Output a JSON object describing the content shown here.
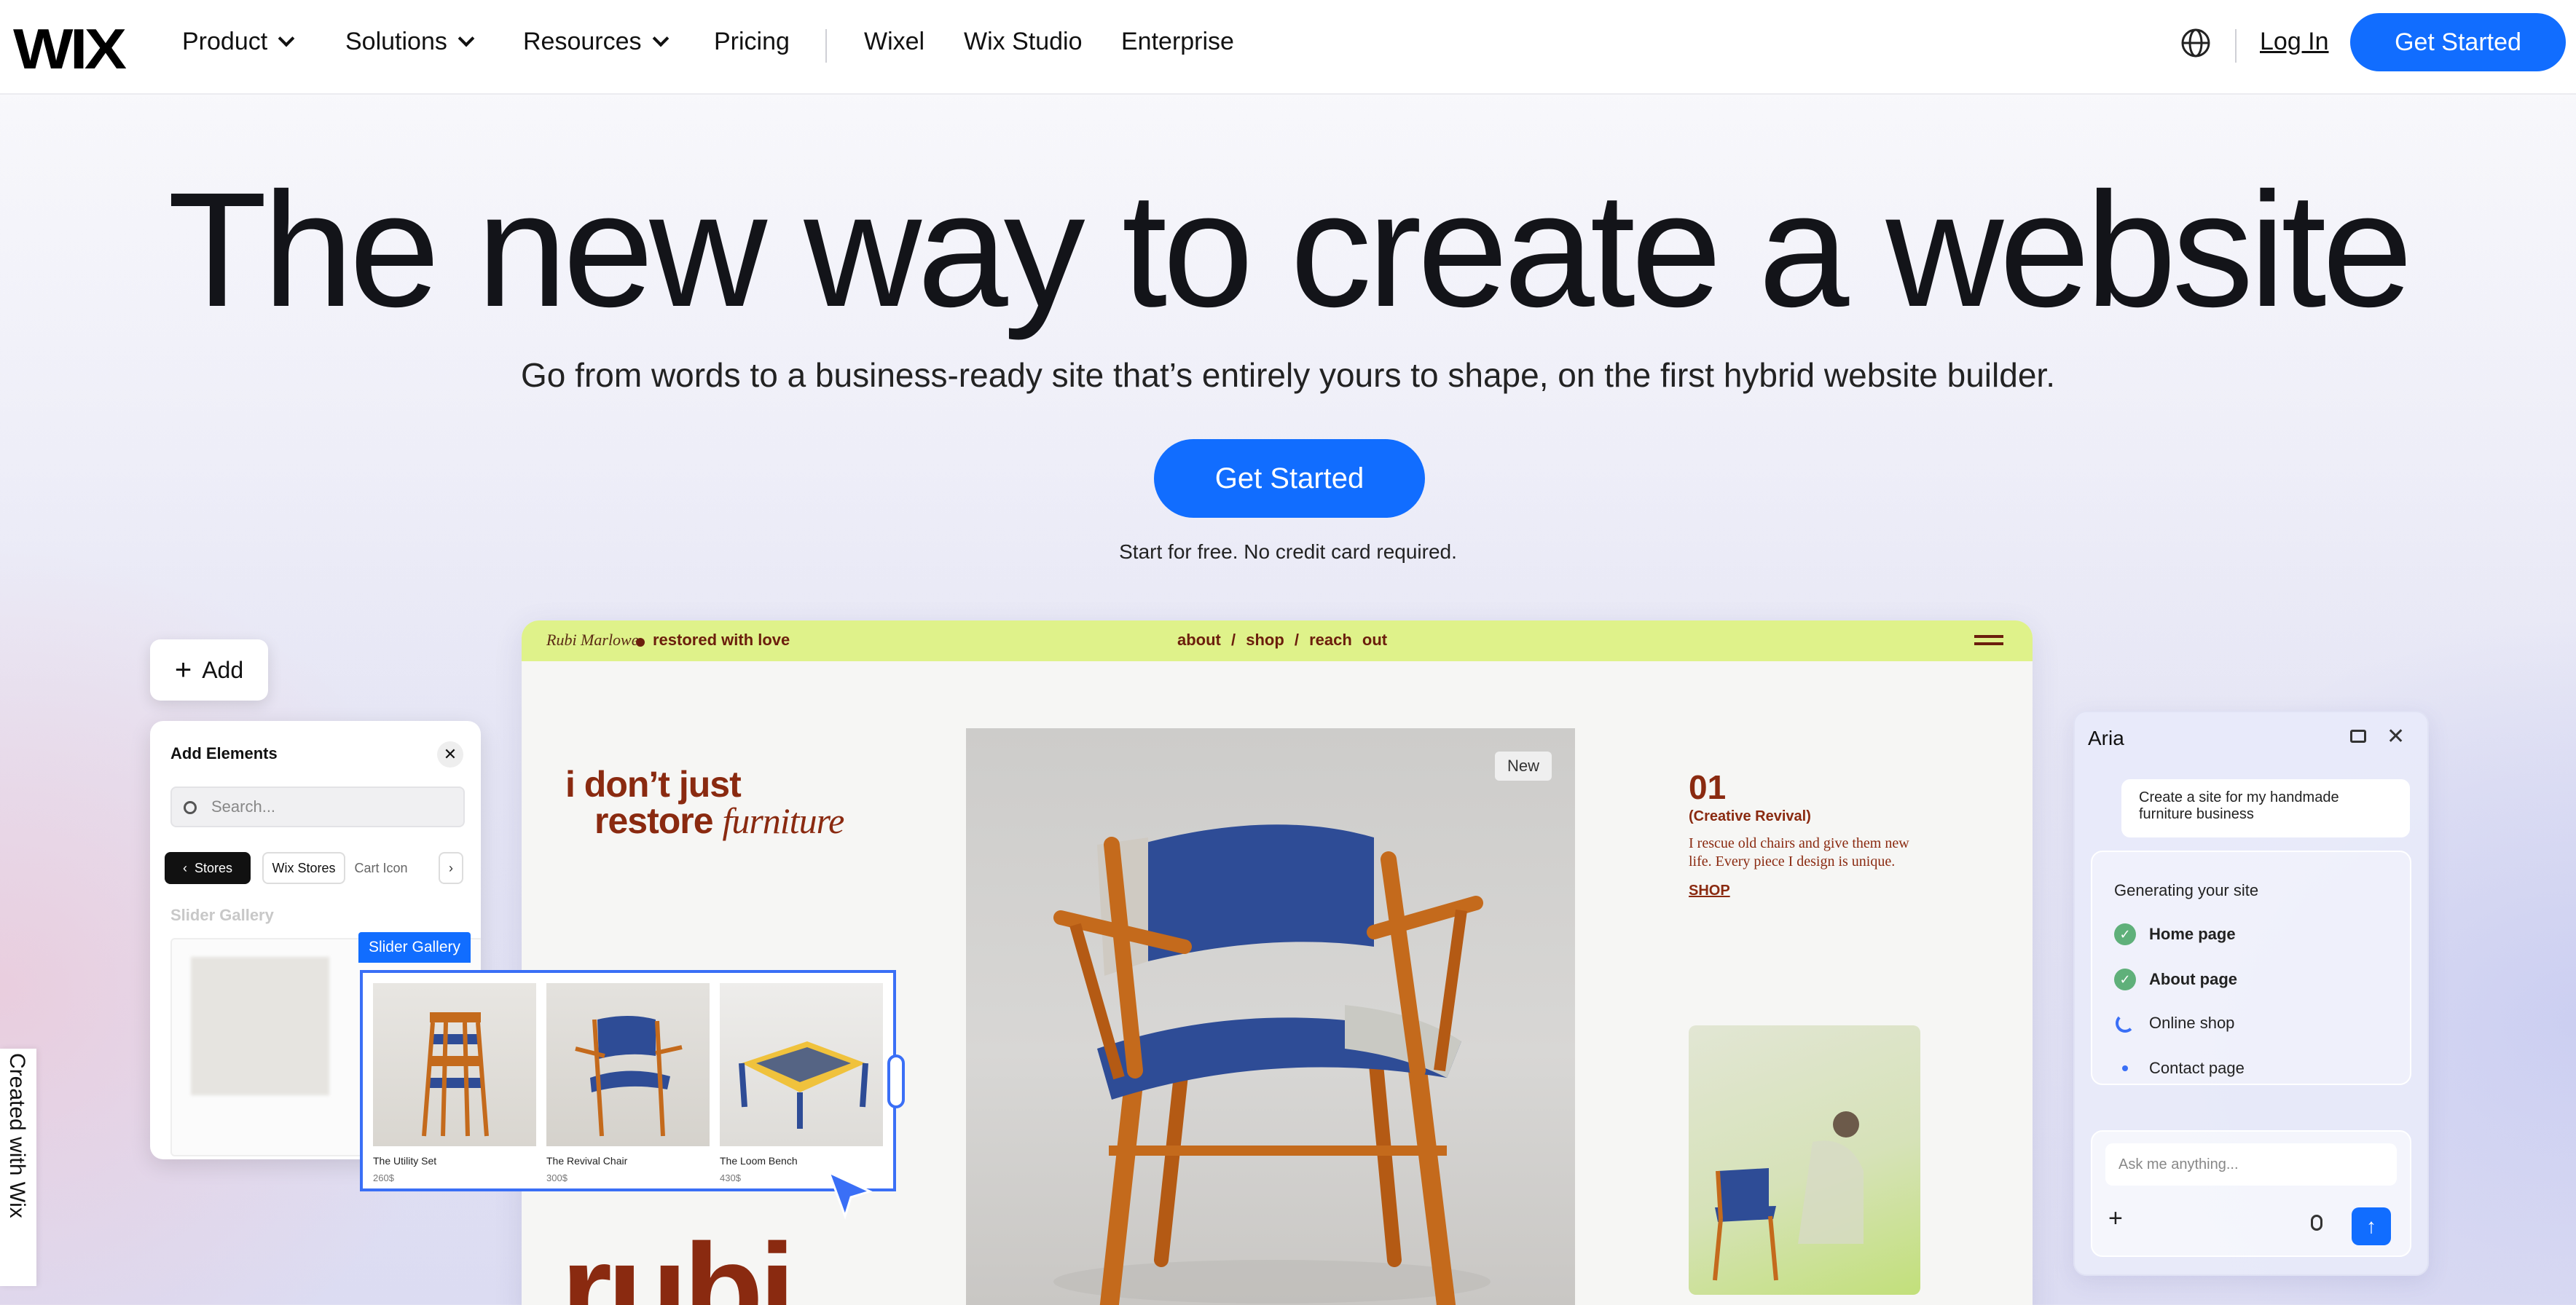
{
  "nav": {
    "logo": "WIX",
    "items": [
      {
        "label": "Product",
        "dropdown": true
      },
      {
        "label": "Solutions",
        "dropdown": true
      },
      {
        "label": "Resources",
        "dropdown": true
      },
      {
        "label": "Pricing",
        "dropdown": false
      },
      {
        "label": "Wixel",
        "dropdown": false
      },
      {
        "label": "Wix Studio",
        "dropdown": false
      },
      {
        "label": "Enterprise",
        "dropdown": false
      }
    ],
    "language_icon": "globe-icon",
    "login": "Log In",
    "cta": "Get Started"
  },
  "hero": {
    "title": "The new way to create a website",
    "subtitle": "Go from words to a business-ready site that’s entirely yours to shape, on the first hybrid website builder.",
    "cta": "Get Started",
    "note": "Start for free. No credit card required."
  },
  "editor": {
    "add_button": "Add",
    "add_elements": {
      "title": "Add Elements",
      "search_placeholder": "Search...",
      "chips": [
        "Stores",
        "Wix Stores",
        "Cart Icon"
      ],
      "section": "Slider Gallery"
    },
    "slider_gallery": {
      "label": "Slider Gallery",
      "items": [
        {
          "name": "The Utility Set",
          "price": "260$"
        },
        {
          "name": "The Revival Chair",
          "price": "300$"
        },
        {
          "name": "The Loom Bench",
          "price": "430$"
        }
      ]
    },
    "created_with": "Created with Wix"
  },
  "site": {
    "brand": "Rubi Marlowe",
    "tagline": "restored with love",
    "menu": "about / shop / reach out",
    "headline_1": "i don’t just",
    "headline_2": "restore",
    "headline_3": "furniture",
    "big_word": "rubi",
    "badge": "New",
    "number": "01",
    "subtitle": "(Creative Revival)",
    "body": "I rescue old chairs and give them new life. Every piece I design is unique.",
    "shop_link": "SHOP"
  },
  "aria": {
    "title": "Aria",
    "user_message": "Create a site for my handmade furniture business",
    "progress_title": "Generating your site",
    "steps": [
      {
        "label": "Home page",
        "status": "done"
      },
      {
        "label": "About page",
        "status": "done"
      },
      {
        "label": "Online shop",
        "status": "in-progress"
      },
      {
        "label": "Contact page",
        "status": "pending"
      }
    ],
    "input_placeholder": "Ask me anything...",
    "accent": "#116dff"
  }
}
